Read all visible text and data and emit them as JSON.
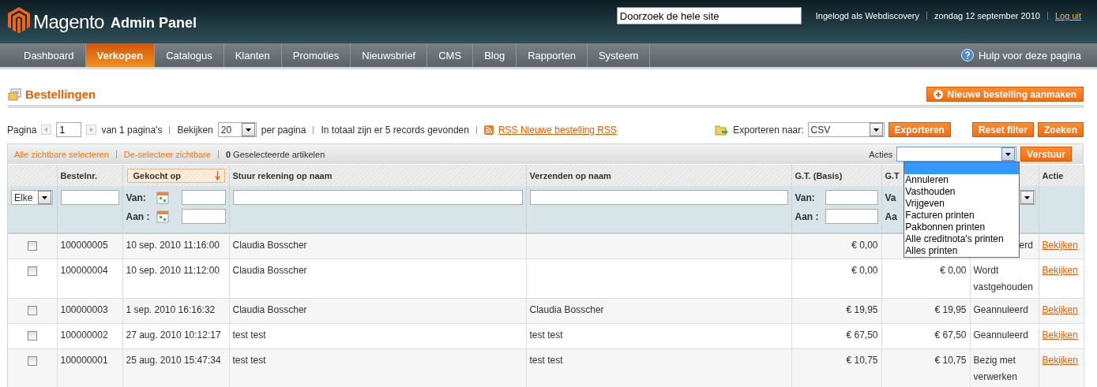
{
  "header": {
    "logo_name": "Magento",
    "logo_suffix": "Admin Panel",
    "search": {
      "value": "Doorzoek de hele site"
    },
    "user": "Ingelogd als Webdiscovery",
    "date": "zondag 12 september 2010",
    "logout": "Log uit"
  },
  "nav": {
    "items": [
      {
        "label": "Dashboard",
        "selected": false
      },
      {
        "label": "Verkopen",
        "selected": true
      },
      {
        "label": "Catalogus",
        "selected": false
      },
      {
        "label": "Klanten",
        "selected": false
      },
      {
        "label": "Promoties",
        "selected": false
      },
      {
        "label": "Nieuwsbrief",
        "selected": false
      },
      {
        "label": "CMS",
        "selected": false
      },
      {
        "label": "Blog",
        "selected": false
      },
      {
        "label": "Rapporten",
        "selected": false
      },
      {
        "label": "Systeem",
        "selected": false
      }
    ],
    "help": "Hulp voor deze pagina"
  },
  "page": {
    "title": "Bestellingen",
    "new_button": "Nieuwe bestelling aanmaken"
  },
  "pager": {
    "page_label": "Pagina",
    "page": "1",
    "of_pages": "van 1 pagina's",
    "view_label": "Bekijken",
    "per_page": "20",
    "per_page_label": "per pagina",
    "total": "In totaal zijn er 5 records gevonden",
    "rss": "RSS Nieuwe bestelling RSS",
    "export_label": "Exporteren naar:",
    "export_format": "CSV",
    "export_button": "Exporteren",
    "reset_button": "Reset filter",
    "search_button": "Zoeken"
  },
  "massaction": {
    "select_all": "Alle zichtbare selecteren",
    "deselect": "De-selecteer zichtbare",
    "count_text": "**0** Geselecteerde artikelen",
    "actions_label": "Acties",
    "expanded": true,
    "options": [
      "Annuleren",
      "Vasthouden",
      "Vrijgeven",
      "Facturen printen",
      "Pakbonnen printen",
      "Alle creditnota's printen",
      "Alles printen"
    ],
    "submit": "Verstuur"
  },
  "columns": [
    {
      "kind": "select",
      "filter_value": "Elke"
    },
    {
      "label": "Bestelnr.",
      "sorted": false,
      "kind": "text"
    },
    {
      "label": "Gekocht op",
      "sorted": true,
      "kind": "date-range",
      "from": "Van:",
      "to": "Aan :"
    },
    {
      "label": "Stuur rekening op naam",
      "sorted": false,
      "kind": "text"
    },
    {
      "label": "Verzenden op naam",
      "sorted": false,
      "kind": "text"
    },
    {
      "label": "G.T. (Basis)",
      "sorted": false,
      "kind": "range",
      "from": "Van:",
      "to": "Aan :"
    },
    {
      "label": "G.T",
      "sorted": false,
      "kind": "range",
      "from": "Va",
      "to": "Aa"
    },
    {
      "kind": "select"
    },
    {
      "label": "Actie",
      "sorted": false,
      "kind": "none"
    }
  ],
  "rows": [
    {
      "checked": false,
      "order": "100000005",
      "date": "10 sep. 2010 11:16:00",
      "bill_to": "Claudia Bosscher",
      "base": "€ 0,00",
      "status": "erd",
      "action": "Bekijken"
    },
    {
      "checked": false,
      "order": "100000004",
      "date": "10 sep. 2010 11:12:00",
      "bill_to": "Claudia Bosscher",
      "base": "€ 0,00",
      "purchased": "€ 0,00",
      "status": "Wordt vastgehouden",
      "action": "Bekijken"
    },
    {
      "checked": false,
      "order": "100000003",
      "date": "1 sep. 2010 16:16:32",
      "bill_to": "Claudia Bosscher",
      "ship_to": "Claudia Bosscher",
      "base": "€ 19,95",
      "purchased": "€ 19,95",
      "status": "Geannuleerd",
      "action": "Bekijken"
    },
    {
      "checked": false,
      "order": "100000002",
      "date": "27 aug. 2010 10:12:17",
      "bill_to": "test test",
      "ship_to": "test test",
      "base": "€ 67,50",
      "purchased": "€ 67,50",
      "status": "Geannuleerd",
      "action": "Bekijken"
    },
    {
      "checked": false,
      "order": "100000001",
      "date": "25 aug. 2010 15:47:34",
      "bill_to": "test test",
      "ship_to": "test test",
      "base": "€ 10,75",
      "purchased": "€ 10,75",
      "status": "Bezig met verwerken",
      "action": "Bekijken"
    }
  ]
}
